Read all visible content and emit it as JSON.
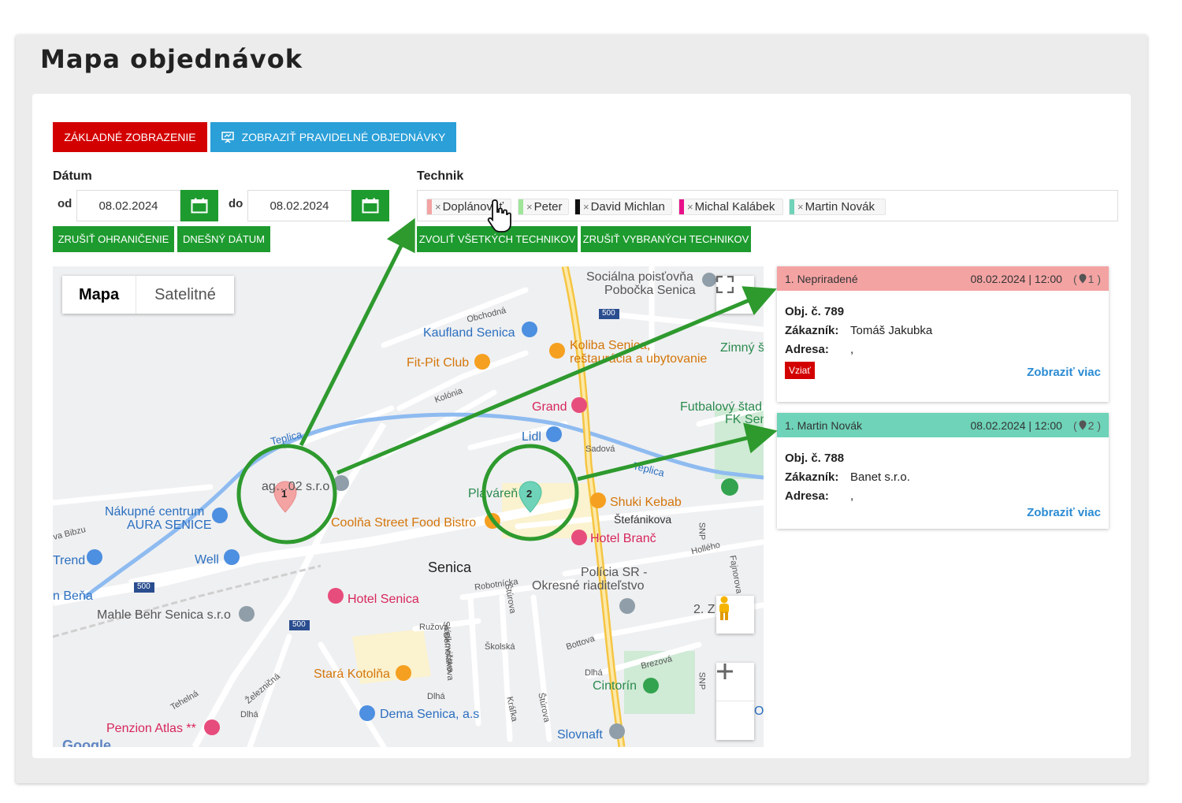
{
  "page": {
    "title": "Mapa objednávok"
  },
  "toolbar": {
    "basic_view": "ZÁKLADNÉ ZOBRAZENIE",
    "show_regular": "ZOBRAZIŤ PRAVIDELNÉ OBJEDNÁVKY"
  },
  "filters": {
    "date_label": "Dátum",
    "from_label": "od",
    "to_label": "do",
    "date_from": "08.02.2024",
    "date_to": "08.02.2024",
    "clear_limit": "ZRUŠIŤ OHRANIČENIE",
    "today": "DNEŠNÝ DÁTUM",
    "technician_label": "Technik",
    "select_all": "ZVOLIŤ VŠETKÝCH TECHNIKOV",
    "clear_selected": "ZRUŠIŤ VYBRANÝCH TECHNIKOV",
    "technicians": [
      {
        "name": "Doplánovať",
        "color": "#f4a3a3"
      },
      {
        "name": "Peter",
        "color": "#9fe59a"
      },
      {
        "name": "David Michlan",
        "color": "#111111"
      },
      {
        "name": "Michal Kalábek",
        "color": "#e8118a"
      },
      {
        "name": "Martin Novák",
        "color": "#6ed3b8"
      }
    ]
  },
  "map": {
    "type_map": "Mapa",
    "type_satellite": "Satelitné",
    "labels": {
      "socialna": "Sociálna poisťovňa",
      "pobocka": "Pobočka Senica",
      "obchodna": "Obchodná",
      "kaufland": "Kaufland Senica",
      "koliba1": "Koliba Senica,",
      "koliba2": "reštaurácia a ubytovanie",
      "zimny": "Zimný š",
      "fitpit": "Fit-Pit Club",
      "kolonia": "Kolónia",
      "grand": "Grand",
      "futbal1": "Futbalový štad",
      "futbal2": "FK Sen",
      "lidl": "Lidl",
      "sadova": "Sadová",
      "teplica1": "Teplica",
      "teplica2": "Teplica",
      "ag": "ag…02 s.r.o",
      "plavaren": "Plaváreň",
      "shuki": "Shuki Kebab",
      "aura1": "Nákupné centrum",
      "aura2": "AURA SENICE",
      "coolna": "Coolňa Street Food Bistro",
      "stefanikova": "Štefánikova",
      "bibzu": "va Bibzu",
      "hotel_branc": "Hotel Branč",
      "hollho": "Hollého",
      "trend": "Trend",
      "well": "Well",
      "senica": "Senica",
      "policia1": "Polícia SR -",
      "policia2": "Okresné riaditeľstvo",
      "fajnorova": "Fajnorova",
      "bena": "n Beňa",
      "robotnicka": "Robotnícka",
      "hotel_senica": "Hotel Senica",
      "dvaz": "2. Z",
      "mahle": "Mahle Behr Senica s.r.o",
      "ruzova": "Ružová",
      "sladkovicova": "Sládkovičova",
      "sturova": "Štúrova",
      "bernolakova": "Bernolákova",
      "skolska": "Školská",
      "bottova": "Bottova",
      "brezova": "Brezová",
      "dlha1": "Dlhá",
      "stara": "Stará Kotolňa",
      "cintorin": "Cintorín",
      "zeleznicna": "Železničná",
      "tehelna": "Tehelná",
      "dlha2": "Dlhá",
      "kralka": "Kráľka",
      "sturova2": "Štúrova",
      "dema": "Dema Senica, a.s",
      "atlas": "Penzion Atlas **",
      "slovnaft": "Slovnaft",
      "google": "Google",
      "snp1": "SNP",
      "snp2": "SNP",
      "road500a": "500",
      "road500b": "500",
      "road500c": "500",
      "cluster1": "1",
      "cluster2": "2",
      "o_right": "O"
    }
  },
  "orders": [
    {
      "title": "1. Nepriradené",
      "datetime": "08.02.2024 | 12:00",
      "count": "1",
      "color": "#f4a3a3",
      "number_label": "Obj. č. 789",
      "customer_key": "Zákazník:",
      "customer": "Tomáš Jakubka",
      "address_key": "Adresa:",
      "address": ",",
      "badge": "Vziať",
      "more": "Zobraziť viac"
    },
    {
      "title": "1. Martin Novák",
      "datetime": "08.02.2024 | 12:00",
      "count": "2",
      "color": "#6ed3b8",
      "number_label": "Obj. č. 788",
      "customer_key": "Zákazník:",
      "customer": "Banet s.r.o.",
      "address_key": "Adresa:",
      "address": ",",
      "more": "Zobraziť viac"
    }
  ]
}
